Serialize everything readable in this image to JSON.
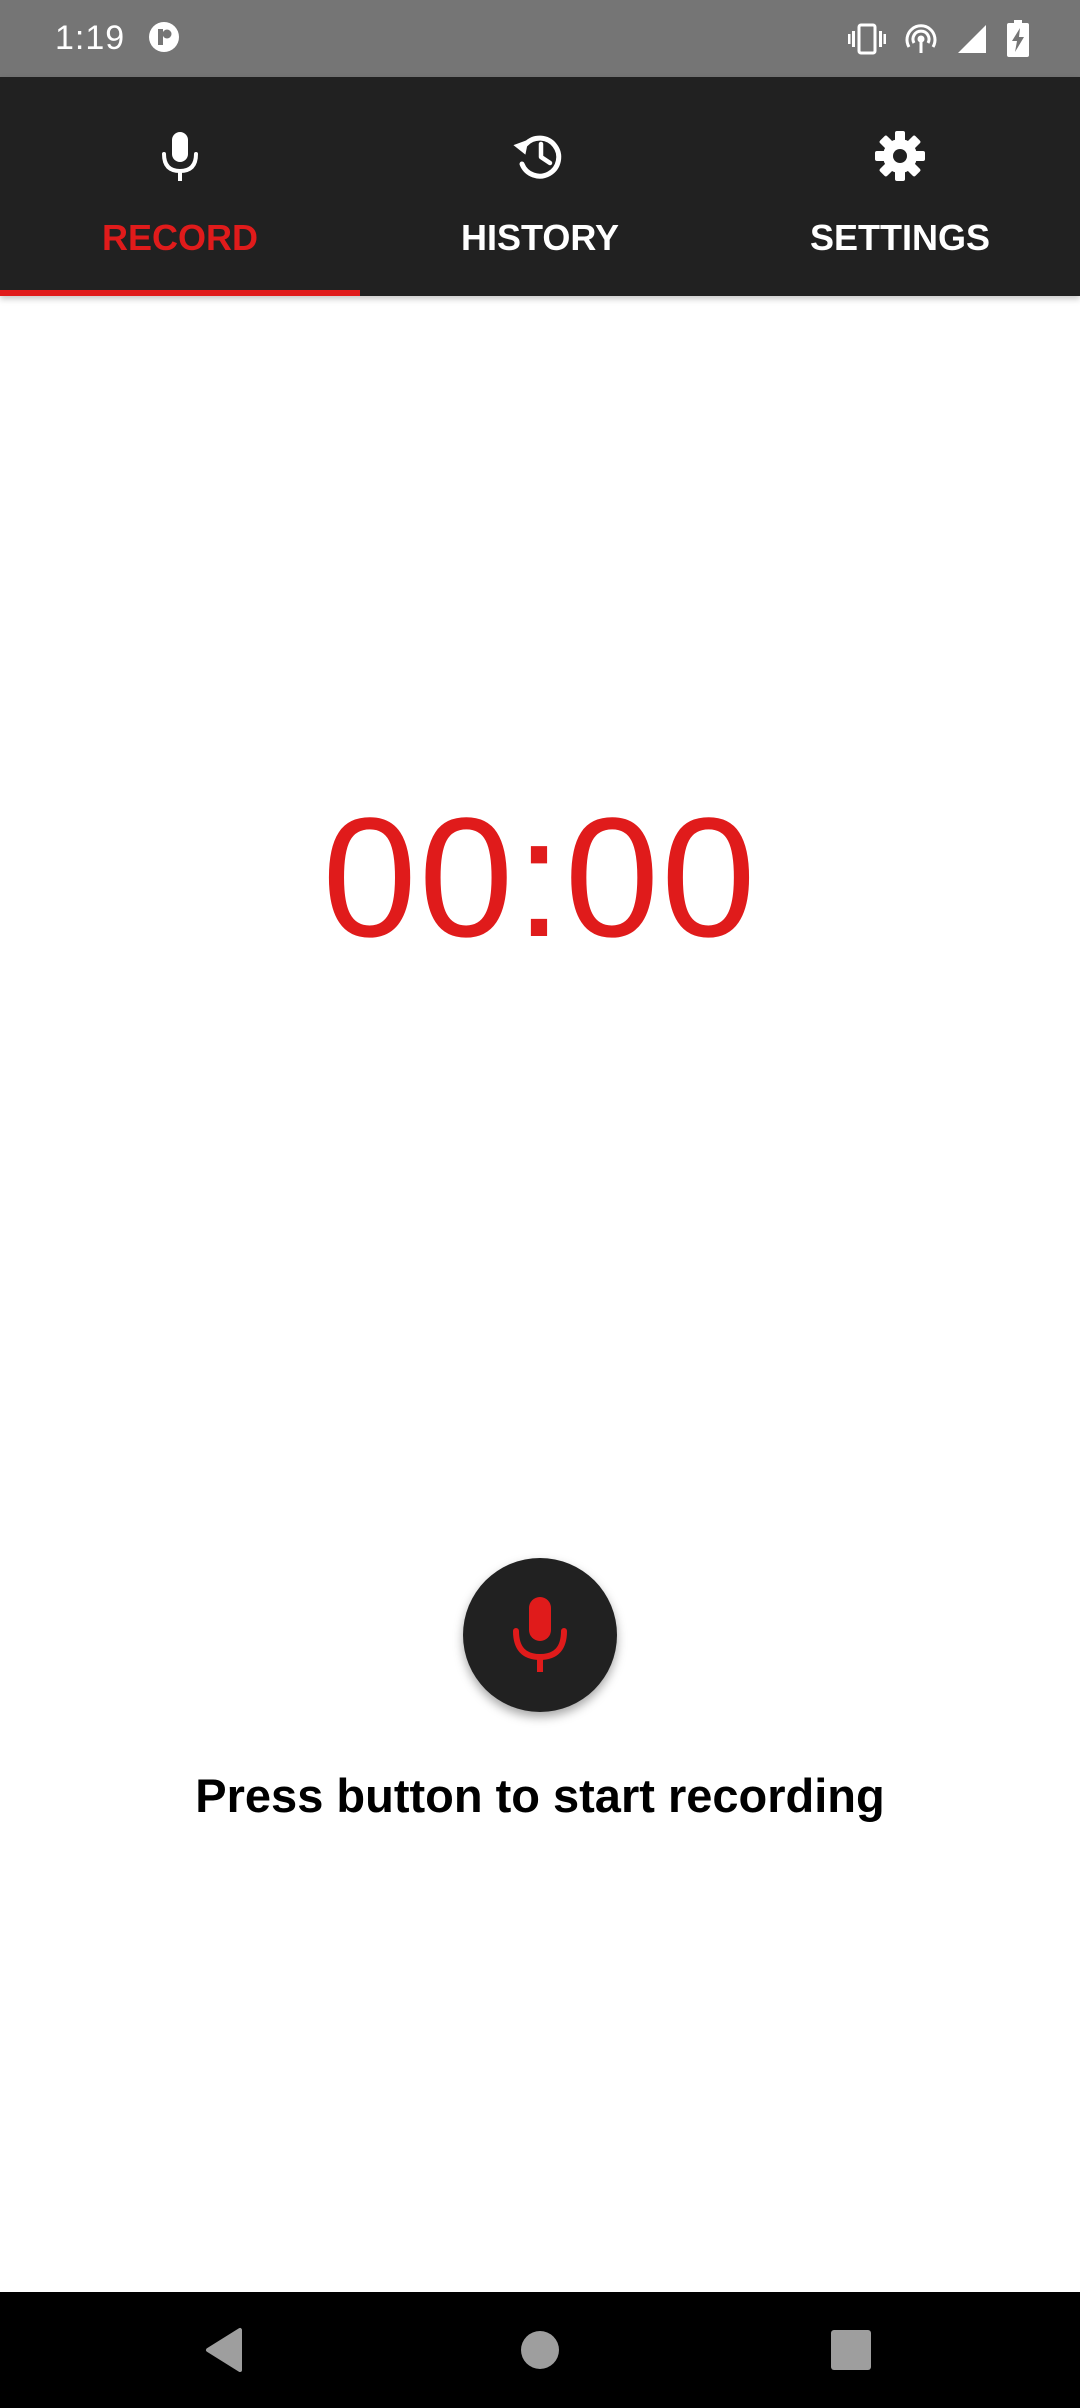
{
  "status_bar": {
    "time": "1:19",
    "icons": [
      "app-notification-icon",
      "vibrate-icon",
      "hotspot-icon",
      "cell-signal-icon",
      "battery-charging-icon"
    ]
  },
  "tabs": [
    {
      "label": "RECORD",
      "icon": "microphone-icon",
      "active": true
    },
    {
      "label": "HISTORY",
      "icon": "history-icon",
      "active": false
    },
    {
      "label": "SETTINGS",
      "icon": "gear-icon",
      "active": false
    }
  ],
  "recorder": {
    "timer": "00:00",
    "button_icon": "microphone-icon",
    "hint": "Press button to start recording"
  },
  "nav_bar": {
    "buttons": [
      "back-icon",
      "home-icon",
      "recents-icon"
    ]
  },
  "colors": {
    "accent": "#e01b1b",
    "toolbar": "#212121",
    "status_bar": "#757575",
    "nav_bar": "#000000"
  }
}
